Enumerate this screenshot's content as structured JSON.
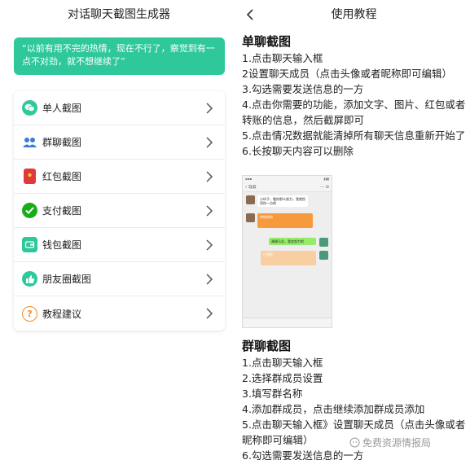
{
  "left": {
    "title": "对话聊天截图生成器",
    "quote": "“以前有用不完的热情，现在不行了，察觉到有一点不对劲，就不想继续了”",
    "menu": [
      {
        "label": "单人截图",
        "icon": "wechat-chat-icon",
        "color": "#2ec89b"
      },
      {
        "label": "群聊截图",
        "icon": "group-users-icon",
        "color": "#3a7bd5"
      },
      {
        "label": "红包截图",
        "icon": "red-packet-icon",
        "color": "#e0393b"
      },
      {
        "label": "支付截图",
        "icon": "payment-check-icon",
        "color": "#1aad19"
      },
      {
        "label": "钱包截图",
        "icon": "wallet-icon",
        "color": "#2ec89b"
      },
      {
        "label": "朋友圈截图",
        "icon": "thumbs-up-icon",
        "color": "#2ec89b"
      },
      {
        "label": "教程建议",
        "icon": "question-icon",
        "color": "#f08a24"
      }
    ]
  },
  "right": {
    "title": "使用教程",
    "single": {
      "heading": "单聊截图",
      "steps": [
        "1.点击聊天输入框",
        "2设置聊天成员（点击头像或者昵称即可编辑）",
        "3.勾选需要发送信息的一方",
        "4.点击你需要的功能，添加文字、图片、红包或者转账的信息，然后截屏即可",
        "5.点击情况数据就能清掉所有聊天信息重新开始了",
        "6.长按聊天内容可以删除"
      ]
    },
    "phone": {
      "nav_back": "‹",
      "nav_title": "马云",
      "msg1": "小伙子，看你那么努力，我就投资你一点吧",
      "transfer1": "转账给你",
      "reply": "谢谢马总，我会努力的",
      "transfer2": "已收款"
    },
    "group": {
      "heading": "群聊截图",
      "steps": [
        "1.点击聊天输入框",
        "2.选择群成员设置",
        "3.填写群名称",
        "4.添加群成员，点击继续添加群成员添加",
        "5.点击聊天输入框》设置聊天成员（点击头像或者昵称即可编辑）",
        "6.勾选需要发送信息的一方"
      ]
    }
  },
  "watermark": "免费资源情报局",
  "colors": {
    "accent": "#2ec89b"
  }
}
